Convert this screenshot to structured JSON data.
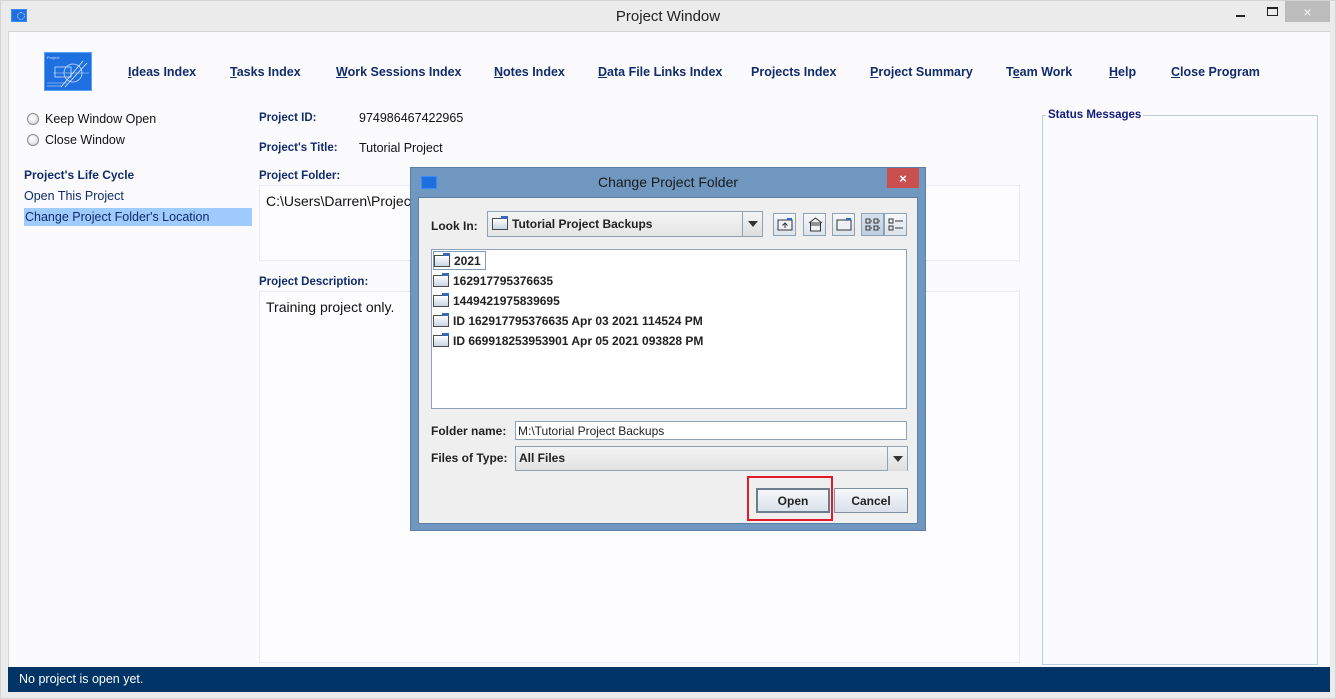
{
  "window": {
    "title": "Project Window",
    "controls": {
      "minimize": "minimize",
      "maximize": "maximize",
      "close": "×"
    }
  },
  "nav": {
    "items": [
      {
        "label": "Ideas Index",
        "mnemonic": "I"
      },
      {
        "label": "Tasks Index",
        "mnemonic": "T"
      },
      {
        "label": "Work Sessions Index",
        "mnemonic": "W"
      },
      {
        "label": "Notes Index",
        "mnemonic": "N"
      },
      {
        "label": "Data File Links Index",
        "mnemonic": "D"
      },
      {
        "label": "Projects Index",
        "mnemonic": ""
      },
      {
        "label": "Project Summary",
        "mnemonic": "P"
      },
      {
        "label": "Team Work",
        "mnemonic": "e"
      },
      {
        "label": "Help",
        "mnemonic": "H"
      },
      {
        "label": "Close Program",
        "mnemonic": "C"
      }
    ]
  },
  "sidebar": {
    "radio_options": [
      {
        "label": "Keep Window Open",
        "selected": false
      },
      {
        "label": "Close Window",
        "selected": false
      }
    ],
    "section_heading": "Project's Life Cycle",
    "items": [
      {
        "label": "Open This Project",
        "selected": false
      },
      {
        "label": "Change Project Folder's Location",
        "selected": true
      }
    ]
  },
  "project": {
    "id_label": "Project ID:",
    "id_value": "974986467422965",
    "title_label": "Project's Title:",
    "title_value": "Tutorial Project",
    "folder_label": "Project Folder:",
    "folder_value": "C:\\Users\\Darren\\Projec",
    "description_label": "Project Description:",
    "description_value": "Training project only."
  },
  "status_panel": {
    "title": "Status Messages",
    "messages": []
  },
  "statusbar": {
    "text": "No project is open yet."
  },
  "dialog": {
    "title": "Change Project Folder",
    "close_label": "×",
    "look_in_label": "Look In:",
    "look_in_value": "Tutorial Project Backups",
    "toolbar": [
      "up-one-level",
      "home",
      "new-folder",
      "list-view",
      "details-view"
    ],
    "files": [
      "2021",
      "162917795376635",
      "1449421975839695",
      "ID 162917795376635 Apr 03 2021 114524 PM",
      "ID 669918253953901 Apr 05 2021 093828 PM"
    ],
    "folder_name_label": "Folder name:",
    "folder_name_value": "M:\\Tutorial Project Backups",
    "files_of_type_label": "Files of Type:",
    "files_of_type_value": "All Files",
    "open_label": "Open",
    "cancel_label": "Cancel"
  },
  "colors": {
    "nav_text": "#112b6b",
    "statusbar_bg": "#003366",
    "selection": "#9fcbff",
    "dialog_frame": "#6f97c0",
    "highlight": "#e21b2b"
  }
}
